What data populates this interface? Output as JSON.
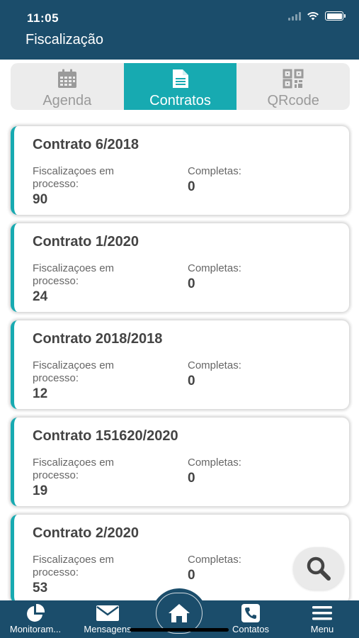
{
  "status_bar": {
    "time": "11:05"
  },
  "header": {
    "title": "Fiscalização"
  },
  "tabs": [
    {
      "label": "Agenda",
      "icon": "calendar-icon",
      "active": false
    },
    {
      "label": "Contratos",
      "icon": "document-icon",
      "active": true
    },
    {
      "label": "QRcode",
      "icon": "qrcode-icon",
      "active": false
    }
  ],
  "contracts": [
    {
      "title": "Contrato 6/2018",
      "in_process_label": "Fiscalizaçoes em processo:",
      "in_process_value": "90",
      "completed_label": "Completas:",
      "completed_value": "0"
    },
    {
      "title": "Contrato 1/2020",
      "in_process_label": "Fiscalizaçoes em processo:",
      "in_process_value": "24",
      "completed_label": "Completas:",
      "completed_value": "0"
    },
    {
      "title": "Contrato 2018/2018",
      "in_process_label": "Fiscalizaçoes em processo:",
      "in_process_value": "12",
      "completed_label": "Completas:",
      "completed_value": "0"
    },
    {
      "title": "Contrato 151620/2020",
      "in_process_label": "Fiscalizaçoes em processo:",
      "in_process_value": "19",
      "completed_label": "Completas:",
      "completed_value": "0"
    },
    {
      "title": "Contrato 2/2020",
      "in_process_label": "Fiscalizaçoes em processo:",
      "in_process_value": "53",
      "completed_label": "Completas:",
      "completed_value": "0"
    }
  ],
  "bottom_nav": [
    {
      "label": "Monitoram...",
      "icon": "pie-chart-icon"
    },
    {
      "label": "Mensagens",
      "icon": "envelope-icon"
    },
    {
      "label": "",
      "icon": "home-icon"
    },
    {
      "label": "Contatos",
      "icon": "phone-icon"
    },
    {
      "label": "Menu",
      "icon": "hamburger-icon"
    }
  ],
  "colors": {
    "primary": "#1b4d6b",
    "accent": "#17aab1",
    "tab_bg": "#ececec"
  }
}
